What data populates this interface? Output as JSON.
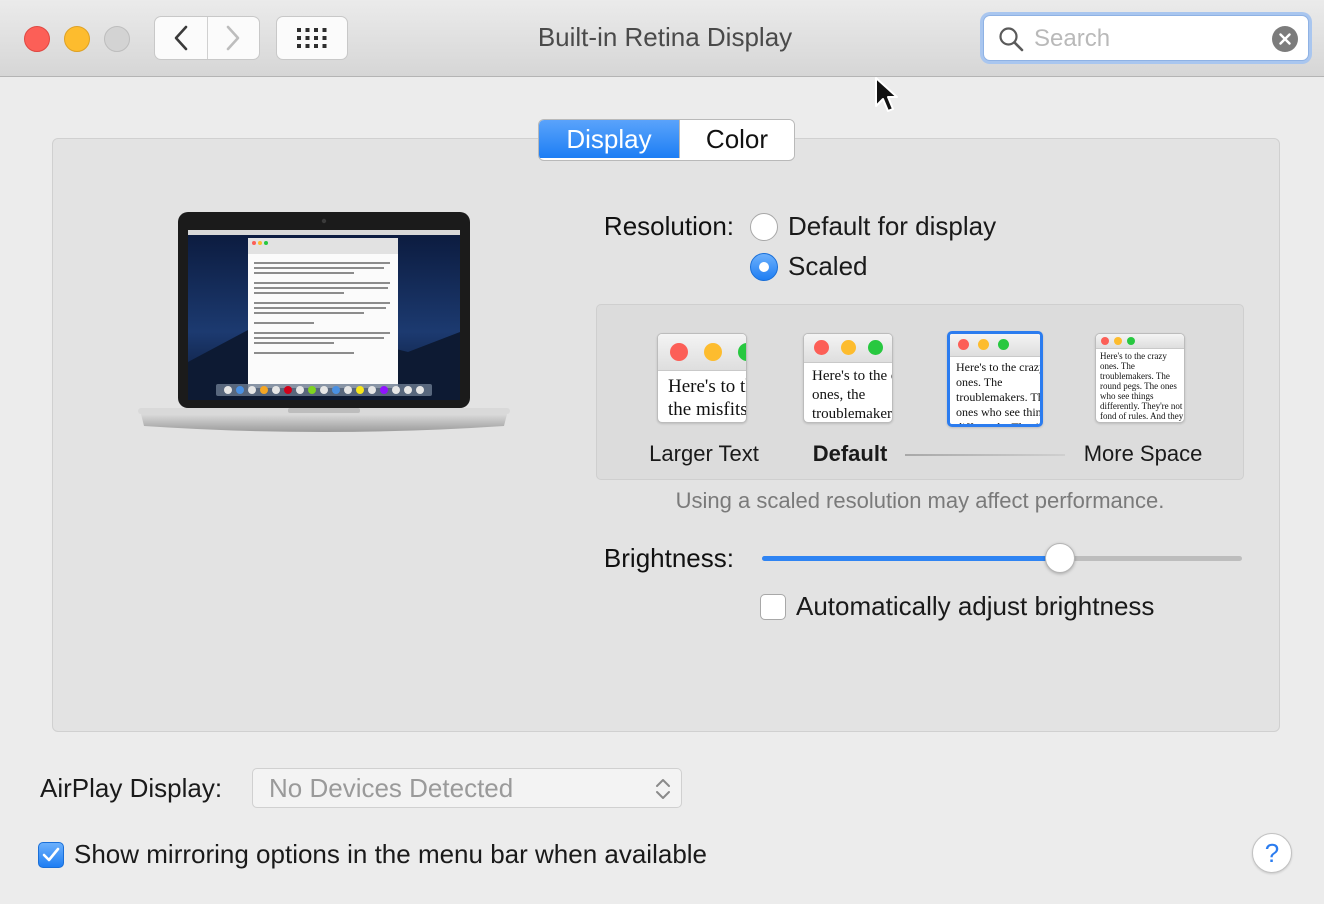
{
  "window": {
    "title": "Built-in Retina Display"
  },
  "toolbar": {
    "search_placeholder": "Search"
  },
  "tabs": [
    {
      "label": "Display",
      "active": true
    },
    {
      "label": "Color",
      "active": false
    }
  ],
  "resolution": {
    "label": "Resolution:",
    "options": [
      {
        "label": "Default for display",
        "selected": false
      },
      {
        "label": "Scaled",
        "selected": true
      }
    ]
  },
  "scaled_options": {
    "thumbs": [
      {
        "label": "Larger Text",
        "sample": "Here's to the crazy ones, the misfits, the troublemakers",
        "selected": false
      },
      {
        "label": "Default",
        "sample": "Here's to the crazy ones, the troublemakers, the ones who see things",
        "selected": false
      },
      {
        "label": "",
        "sample": "Here's to the crazy ones. The troublemakers. The ones who see things differently. They're not fond of rules. And they",
        "selected": true
      },
      {
        "label": "More Space",
        "sample": "Here's to the crazy ones. The troublemakers. The round pegs. The ones who see things differently. They're not fond of rules. And they have no respect for the status quo. You can quote them, disagree with them. About the only thing you can't do is ignore them. Because they change things.",
        "selected": false
      }
    ],
    "note": "Using a scaled resolution may affect performance."
  },
  "brightness": {
    "label": "Brightness:",
    "level": 0.62,
    "auto_label": "Automatically adjust brightness",
    "auto_checked": false
  },
  "airplay": {
    "label": "AirPlay Display:",
    "value": "No Devices Detected"
  },
  "mirroring": {
    "label": "Show mirroring options in the menu bar when available",
    "checked": true
  },
  "help": {
    "glyph": "?"
  },
  "colors": {
    "accent": "#2b7cef",
    "close": "#fc5f57",
    "minimize": "#fdbc2e",
    "zoom_disabled": "#d3d3d3"
  }
}
